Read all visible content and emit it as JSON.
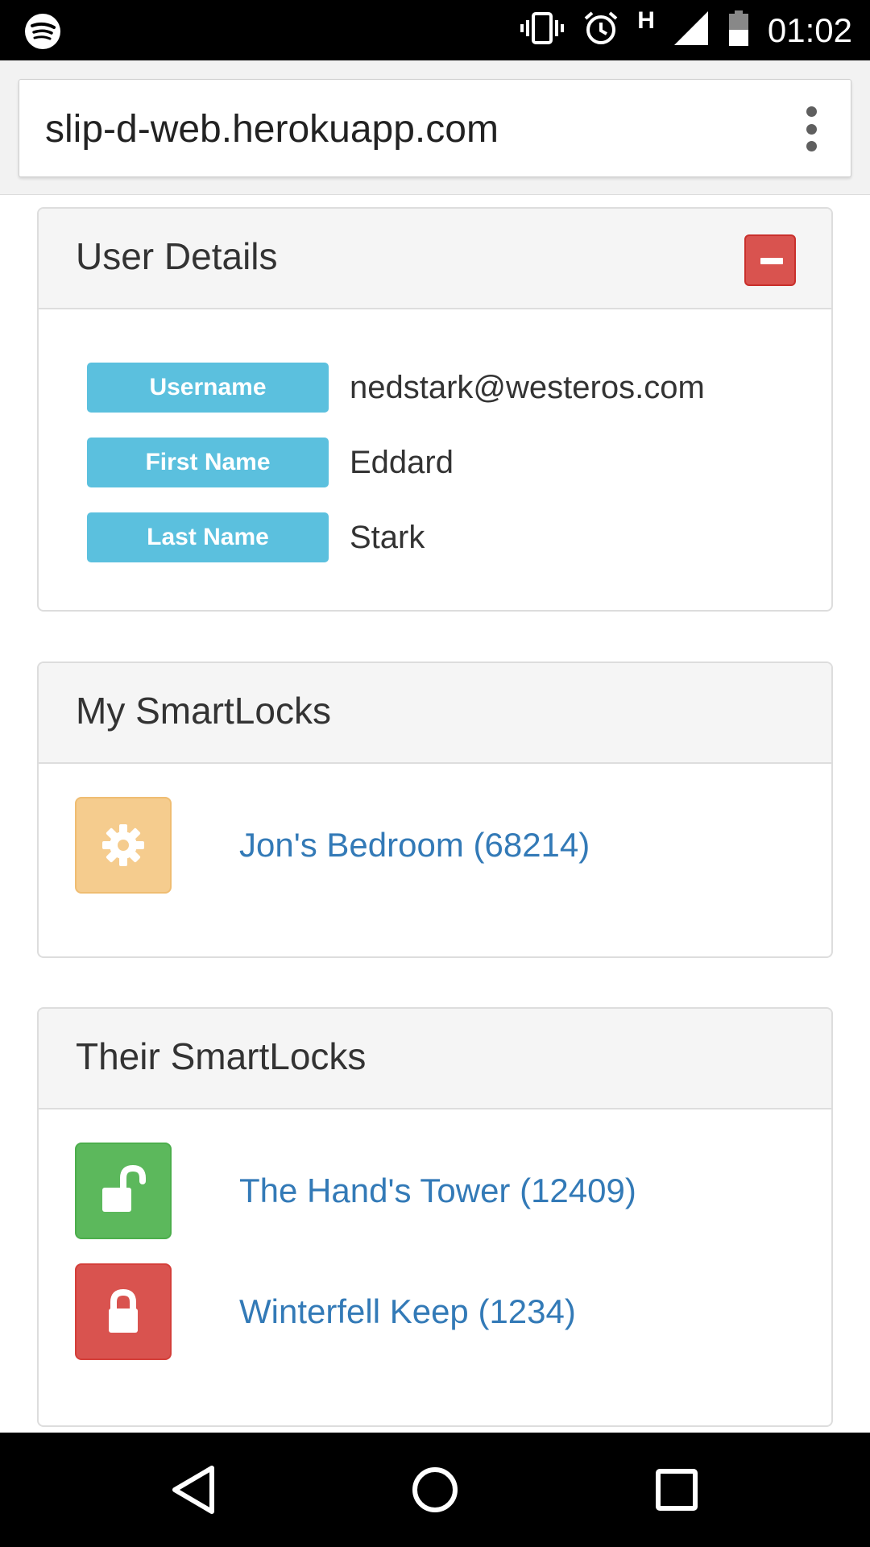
{
  "status_bar": {
    "time": "01:02",
    "network_type": "H",
    "icons": [
      "spotify-icon",
      "vibrate-icon",
      "alarm-icon",
      "signal-icon",
      "battery-icon"
    ]
  },
  "browser": {
    "url": "slip-d-web.herokuapp.com",
    "menu_icon": "overflow-menu-icon"
  },
  "user_details": {
    "title": "User Details",
    "collapse_icon": "minus-icon",
    "fields": [
      {
        "label": "Username",
        "value": "nedstark@westeros.com"
      },
      {
        "label": "First Name",
        "value": "Eddard"
      },
      {
        "label": "Last Name",
        "value": "Stark"
      }
    ]
  },
  "my_smartlocks": {
    "title": "My SmartLocks",
    "items": [
      {
        "name": "Jon's Bedroom (68214)",
        "icon": "gear-icon",
        "status_color": "#f5cc8e"
      }
    ]
  },
  "their_smartlocks": {
    "title": "Their SmartLocks",
    "items": [
      {
        "name": "The Hand's Tower (12409)",
        "icon": "unlock-icon",
        "status_color": "#5cb85c"
      },
      {
        "name": "Winterfell Keep (1234)",
        "icon": "lock-icon",
        "status_color": "#d9534f"
      }
    ]
  },
  "nav_bar": {
    "buttons": [
      "back-icon",
      "home-icon",
      "recents-icon"
    ]
  },
  "colors": {
    "info_label": "#5bc0de",
    "link": "#337ab7",
    "danger": "#d9534f",
    "success": "#5cb85c",
    "warning": "#f5cc8e"
  }
}
